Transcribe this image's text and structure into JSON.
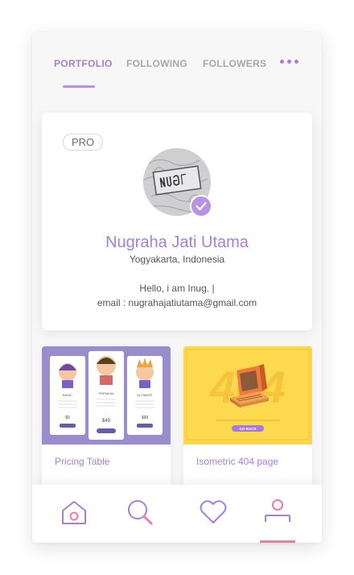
{
  "tabs": {
    "portfolio": "PORTFOLIO",
    "following": "FOLLOWING",
    "followers": "FOLLOWERS",
    "more_icon": "more-dots-icon"
  },
  "profile": {
    "badge": "PRO",
    "name": "Nugraha Jati Utama",
    "location": "Yogyakarta, Indonesia",
    "bio_line1": "Hello, i am Inug. |",
    "bio_line2": "email : nugrahajatiutama@gmail.com",
    "verified_icon": "check-icon"
  },
  "shots": [
    {
      "title": "Pricing Table",
      "plans": [
        "BASIC",
        "PREMIUM",
        "ULTIMATE"
      ],
      "prices": [
        "$9",
        "$49",
        "$99"
      ]
    },
    {
      "title": "Isometric 404 page",
      "headline": "404",
      "button": "GO BACK"
    }
  ],
  "nav": {
    "items": [
      "home-icon",
      "search-icon",
      "heart-icon",
      "profile-icon"
    ],
    "active": "profile"
  },
  "colors": {
    "accent": "#a77fd8",
    "pink": "#f07aa6",
    "card_purple": "#8d7fc0",
    "card_yellow": "#ffd84a"
  }
}
